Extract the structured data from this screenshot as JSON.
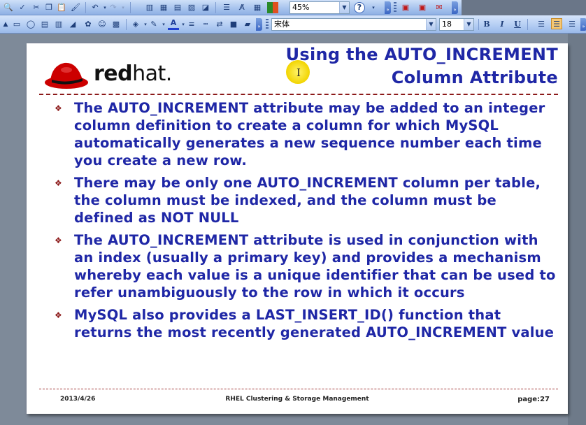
{
  "toolbar": {
    "zoom_value": "45%",
    "font_name": "宋体",
    "font_size": "18",
    "bold_label": "B",
    "italic_label": "I",
    "underline_label": "U"
  },
  "slide": {
    "logo_text_bold": "red",
    "logo_text_light": "hat.",
    "title_line1": "Using the AUTO_INCREMENT",
    "title_line2": "Column Attribute",
    "bullets": [
      "The AUTO_INCREMENT attribute may be added to an integer column definition to create a column for which MySQL automatically generates a new sequence number each time you create a new row.",
      "There may be only one AUTO_INCREMENT column per table, the column must be indexed, and the column must be defined as NOT NULL",
      "The AUTO_INCREMENT attribute is used in conjunction with an index (usually a primary key) and provides a mechanism whereby each value is a unique identifier that can be used to refer unambiguously to the row in which it occurs",
      "MySQL also provides a LAST_INSERT_ID() function that returns the most recently generated AUTO_INCREMENT value"
    ],
    "footer_date": "2013/4/26",
    "footer_center": "RHEL Clustering & Storage Management",
    "footer_page": "page:27"
  },
  "colors": {
    "title_blue": "#1f27a6",
    "rule_red": "#8c1a1a",
    "logo_red": "#cc0000"
  }
}
